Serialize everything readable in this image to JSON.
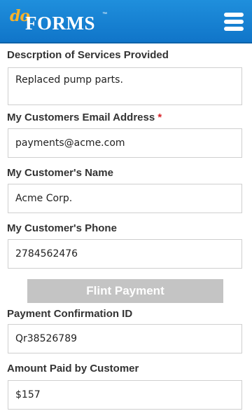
{
  "header": {
    "logo_prefix": "do",
    "logo_text": "FORMS",
    "logo_mark": "™",
    "menu_icon": "hamburger-menu-icon",
    "colors": {
      "bar": "#1582d4",
      "logo_accent": "#f7b22a"
    }
  },
  "form": {
    "description": {
      "label": "Descrption of Services Provided",
      "value": "Replaced pump parts."
    },
    "email": {
      "label": "My Customers Email Address",
      "required_mark": "*",
      "value": "payments@acme.com"
    },
    "customer_name": {
      "label": "My Customer's Name",
      "value": "Acme Corp."
    },
    "customer_phone": {
      "label": "My Customer's Phone",
      "value": "2784562476"
    },
    "payment_button": {
      "label": "Flint Payment"
    },
    "confirmation_id": {
      "label": "Payment Confirmation ID",
      "value": "Qr38526789"
    },
    "amount_paid": {
      "label": "Amount Paid by Customer",
      "value": "$157"
    }
  }
}
